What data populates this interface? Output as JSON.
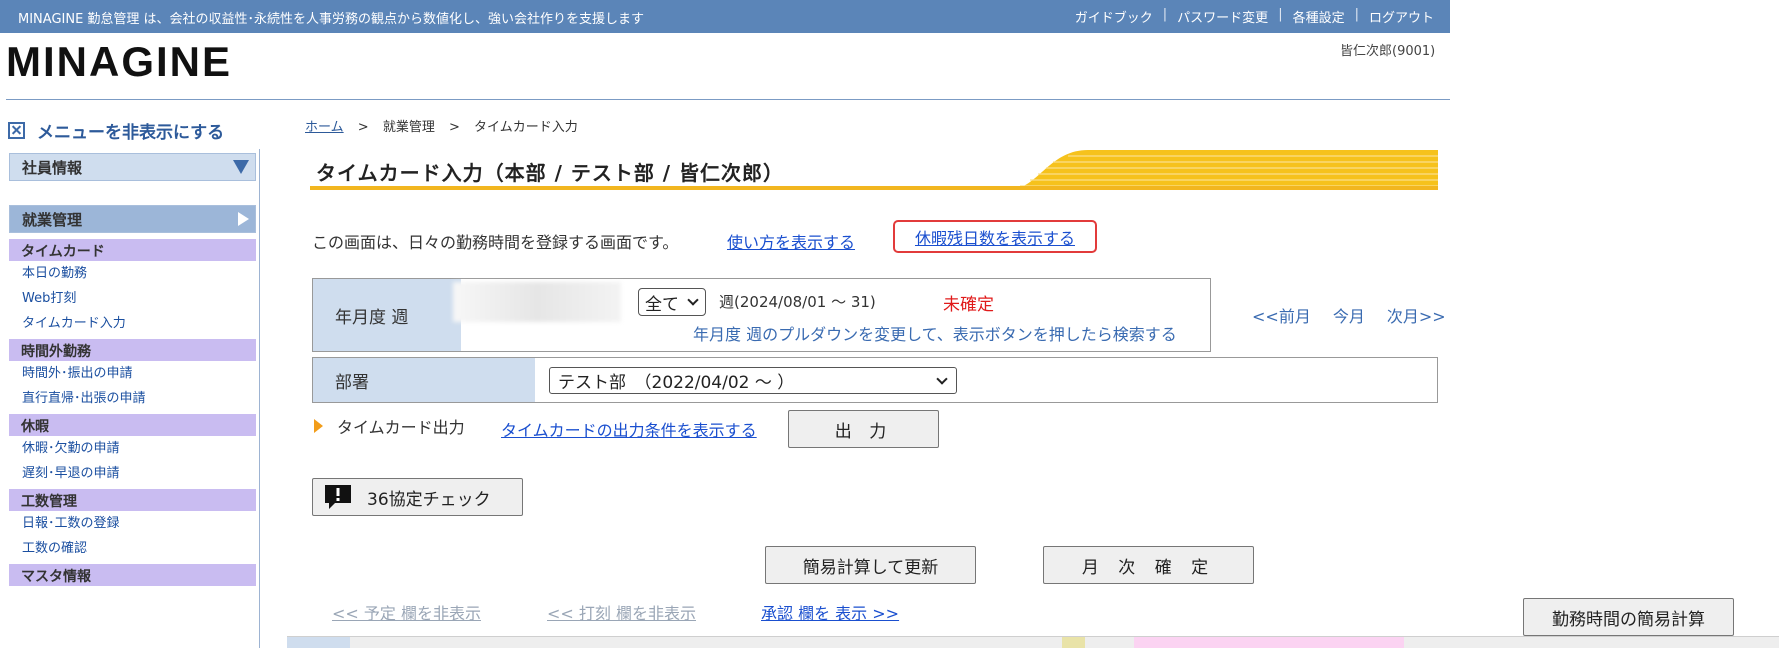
{
  "topbar": {
    "tagline": "MINAGINE 勤怠管理 は、会社の収益性･永続性を人事労務の観点から数値化し、強い会社作りを支援します",
    "links": [
      "ガイドブック",
      "パスワード変更",
      "各種設定",
      "ログアウト"
    ]
  },
  "logo": "MINAGINE",
  "user": "皆仁次郎(9001)",
  "menu_toggle": "メニューを非表示にする",
  "sidebar": {
    "employee_info": "社員情報",
    "work_management": "就業管理",
    "categories": [
      {
        "title": "タイムカード",
        "items": [
          "本日の勤務",
          "Web打刻",
          "タイムカード入力"
        ]
      },
      {
        "title": "時間外勤務",
        "items": [
          "時間外･振出の申請",
          "直行直帰･出張の申請"
        ]
      },
      {
        "title": "休暇",
        "items": [
          "休暇･欠勤の申請",
          "遅刻･早退の申請"
        ]
      },
      {
        "title": "工数管理",
        "items": [
          "日報･工数の登録",
          "工数の確認"
        ]
      },
      {
        "title": "マスタ情報",
        "items": []
      }
    ]
  },
  "breadcrumb": {
    "home": "ホーム",
    "sep1": ">",
    "level1": "就業管理",
    "sep2": ">",
    "level2": "タイムカード入力"
  },
  "page_title": "タイムカード入力（本部 / テスト部 / 皆仁次郎）",
  "intro": {
    "text": "この画面は、日々の勤務時間を登録する画面です。",
    "how_to_link": "使い方を表示する",
    "leave_balance_link": "休暇残日数を表示する"
  },
  "search": {
    "label": "年月度 週",
    "week_filter": "全て",
    "week_range": "週(2024/08/01 ～ 31)",
    "status": "未確定",
    "hint": "年月度 週のプルダウンを変更して、表示ボタンを押したら検索する"
  },
  "month_nav": {
    "prev": "<<前月",
    "current": "今月",
    "next": "次月>>"
  },
  "department": {
    "label": "部署",
    "value": "テスト部　（2022/04/02 ～ ）"
  },
  "output": {
    "label": "タイムカード出力",
    "link": "タイムカードの出力条件を表示する",
    "button": "出 力"
  },
  "buttons": {
    "check36": "36協定チェック",
    "calc": "簡易計算して更新",
    "confirm": "月 次 確 定",
    "simple_calc": "勤務時間の簡易計算"
  },
  "column_toggles": {
    "plan": "<< 予定 欄を非表示",
    "stamp": "<< 打刻 欄を非表示",
    "approval": "承認 欄を 表示 >>"
  },
  "colors": {
    "accent": "#f2b61f",
    "topbar": "#5b85b8",
    "status_red": "#e01b1b",
    "link": "#1a4fcf"
  }
}
